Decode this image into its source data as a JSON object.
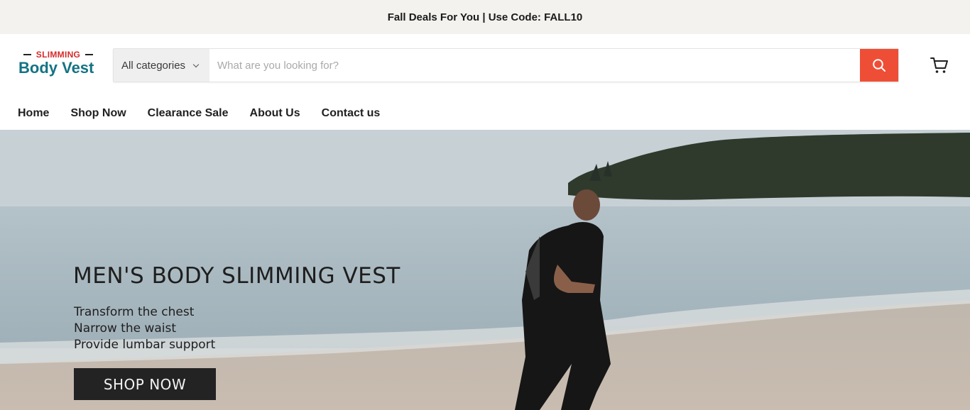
{
  "announcement": {
    "text": "Fall Deals For You | Use Code: FALL10"
  },
  "logo": {
    "small": "SLIMMING",
    "main": "Body Vest"
  },
  "search": {
    "category_label": "All categories",
    "placeholder": "What are you looking for?",
    "value": ""
  },
  "icons": {
    "search": "search-icon",
    "cart": "cart-icon",
    "chevron": "chevron-down-icon"
  },
  "nav": {
    "items": [
      {
        "label": "Home"
      },
      {
        "label": "Shop Now"
      },
      {
        "label": "Clearance Sale"
      },
      {
        "label": "About Us"
      },
      {
        "label": "Contact us"
      }
    ]
  },
  "hero": {
    "title": "MEN'S BODY SLIMMING VEST",
    "lines": [
      "Transform the chest",
      "Narrow the waist",
      "Provide lumbar support"
    ],
    "button": "SHOP NOW"
  },
  "colors": {
    "accent": "#ef4e36",
    "brand": "#137383",
    "logo_red": "#d52a2a",
    "announce_bg": "#f3f2ee"
  }
}
